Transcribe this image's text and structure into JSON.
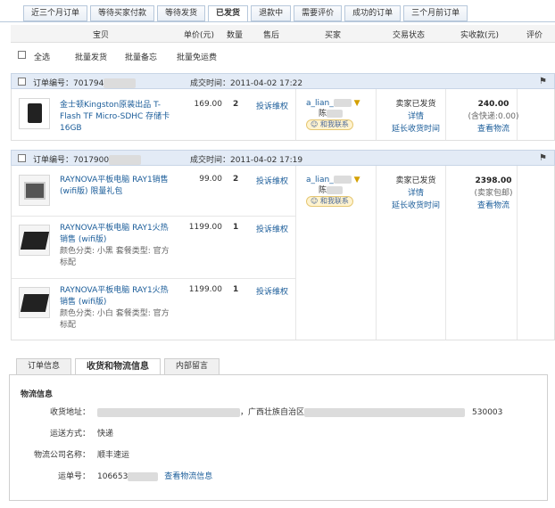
{
  "tabs": [
    "近三个月订单",
    "等待买家付款",
    "等待发货",
    "已发货",
    "退款中",
    "需要评价",
    "成功的订单",
    "三个月前订单"
  ],
  "columns": [
    "宝贝",
    "单价(元)",
    "数量",
    "售后",
    "买家",
    "交易状态",
    "实收款(元)",
    "评价"
  ],
  "toolbar": {
    "select_all": "全选",
    "batch_ship": "批量发货",
    "batch_note": "批量备忘",
    "batch_free_ship": "批量免运费"
  },
  "orders": [
    {
      "no_label": "订单编号：",
      "no": "701794",
      "time_label": "成交时间：",
      "time": "2011-04-02 17:22",
      "buyer_id": "a_lian_",
      "buyer_name": "陈",
      "contact": "和我联系",
      "status": "卖家已发货",
      "detail": "详情",
      "extend": "延长收货时间",
      "total": "240.00",
      "total_note": "(含快递:0.00)",
      "logistics": "查看物流",
      "items": [
        {
          "title": "金士顿Kingston原装出品 T-Flash TF Micro-SDHC 存储卡 16GB",
          "price": "169.00",
          "qty": "2",
          "complaint": "投诉维权"
        }
      ]
    },
    {
      "no_label": "订单编号：",
      "no": "7017900",
      "time_label": "成交时间：",
      "time": "2011-04-02 17:19",
      "buyer_id": "a_lian_",
      "buyer_name": "陈",
      "contact": "和我联系",
      "status": "卖家已发货",
      "detail": "详情",
      "extend": "延长收货时间",
      "total": "2398.00",
      "total_note": "(卖家包邮)",
      "logistics": "查看物流",
      "items": [
        {
          "title": "RAYNOVA平板电脑 RAY1销售 (wifi版) 限量礼包",
          "price": "99.00",
          "qty": "2",
          "complaint": "投诉维权"
        },
        {
          "title": "RAYNOVA平板电脑 RAY1火热销售 (wifi版)",
          "price": "1199.00",
          "qty": "1",
          "complaint": "投诉维权",
          "attr": "颜色分类: 小黑  套餐类型: 官方标配"
        },
        {
          "title": "RAYNOVA平板电脑 RAY1火热销售 (wifi版)",
          "price": "1199.00",
          "qty": "1",
          "complaint": "投诉维权",
          "attr": "颜色分类: 小白  套餐类型: 官方标配"
        }
      ]
    }
  ],
  "detail_tabs": [
    "订单信息",
    "收货和物流信息",
    "内部留言"
  ],
  "logistics": {
    "section": "物流信息",
    "address_label": "收货地址：",
    "address_mid": "，广西壮族自治区",
    "address_zip": "530003",
    "method_label": "运送方式：",
    "method": "快递",
    "company_label": "物流公司名称：",
    "company": "顺丰速运",
    "waybill_label": "运单号：",
    "waybill": "106653",
    "track": "查看物流信息"
  }
}
